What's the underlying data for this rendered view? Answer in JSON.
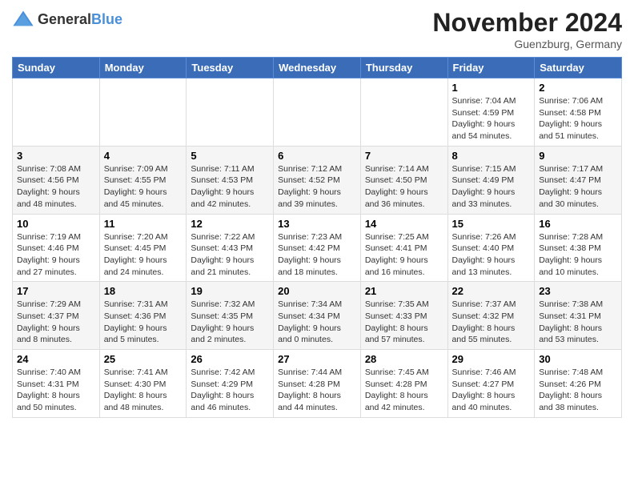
{
  "header": {
    "logo_general": "General",
    "logo_blue": "Blue",
    "month_title": "November 2024",
    "subtitle": "Guenzburg, Germany"
  },
  "weekdays": [
    "Sunday",
    "Monday",
    "Tuesday",
    "Wednesday",
    "Thursday",
    "Friday",
    "Saturday"
  ],
  "weeks": [
    [
      {
        "day": "",
        "info": ""
      },
      {
        "day": "",
        "info": ""
      },
      {
        "day": "",
        "info": ""
      },
      {
        "day": "",
        "info": ""
      },
      {
        "day": "",
        "info": ""
      },
      {
        "day": "1",
        "info": "Sunrise: 7:04 AM\nSunset: 4:59 PM\nDaylight: 9 hours and 54 minutes."
      },
      {
        "day": "2",
        "info": "Sunrise: 7:06 AM\nSunset: 4:58 PM\nDaylight: 9 hours and 51 minutes."
      }
    ],
    [
      {
        "day": "3",
        "info": "Sunrise: 7:08 AM\nSunset: 4:56 PM\nDaylight: 9 hours and 48 minutes."
      },
      {
        "day": "4",
        "info": "Sunrise: 7:09 AM\nSunset: 4:55 PM\nDaylight: 9 hours and 45 minutes."
      },
      {
        "day": "5",
        "info": "Sunrise: 7:11 AM\nSunset: 4:53 PM\nDaylight: 9 hours and 42 minutes."
      },
      {
        "day": "6",
        "info": "Sunrise: 7:12 AM\nSunset: 4:52 PM\nDaylight: 9 hours and 39 minutes."
      },
      {
        "day": "7",
        "info": "Sunrise: 7:14 AM\nSunset: 4:50 PM\nDaylight: 9 hours and 36 minutes."
      },
      {
        "day": "8",
        "info": "Sunrise: 7:15 AM\nSunset: 4:49 PM\nDaylight: 9 hours and 33 minutes."
      },
      {
        "day": "9",
        "info": "Sunrise: 7:17 AM\nSunset: 4:47 PM\nDaylight: 9 hours and 30 minutes."
      }
    ],
    [
      {
        "day": "10",
        "info": "Sunrise: 7:19 AM\nSunset: 4:46 PM\nDaylight: 9 hours and 27 minutes."
      },
      {
        "day": "11",
        "info": "Sunrise: 7:20 AM\nSunset: 4:45 PM\nDaylight: 9 hours and 24 minutes."
      },
      {
        "day": "12",
        "info": "Sunrise: 7:22 AM\nSunset: 4:43 PM\nDaylight: 9 hours and 21 minutes."
      },
      {
        "day": "13",
        "info": "Sunrise: 7:23 AM\nSunset: 4:42 PM\nDaylight: 9 hours and 18 minutes."
      },
      {
        "day": "14",
        "info": "Sunrise: 7:25 AM\nSunset: 4:41 PM\nDaylight: 9 hours and 16 minutes."
      },
      {
        "day": "15",
        "info": "Sunrise: 7:26 AM\nSunset: 4:40 PM\nDaylight: 9 hours and 13 minutes."
      },
      {
        "day": "16",
        "info": "Sunrise: 7:28 AM\nSunset: 4:38 PM\nDaylight: 9 hours and 10 minutes."
      }
    ],
    [
      {
        "day": "17",
        "info": "Sunrise: 7:29 AM\nSunset: 4:37 PM\nDaylight: 9 hours and 8 minutes."
      },
      {
        "day": "18",
        "info": "Sunrise: 7:31 AM\nSunset: 4:36 PM\nDaylight: 9 hours and 5 minutes."
      },
      {
        "day": "19",
        "info": "Sunrise: 7:32 AM\nSunset: 4:35 PM\nDaylight: 9 hours and 2 minutes."
      },
      {
        "day": "20",
        "info": "Sunrise: 7:34 AM\nSunset: 4:34 PM\nDaylight: 9 hours and 0 minutes."
      },
      {
        "day": "21",
        "info": "Sunrise: 7:35 AM\nSunset: 4:33 PM\nDaylight: 8 hours and 57 minutes."
      },
      {
        "day": "22",
        "info": "Sunrise: 7:37 AM\nSunset: 4:32 PM\nDaylight: 8 hours and 55 minutes."
      },
      {
        "day": "23",
        "info": "Sunrise: 7:38 AM\nSunset: 4:31 PM\nDaylight: 8 hours and 53 minutes."
      }
    ],
    [
      {
        "day": "24",
        "info": "Sunrise: 7:40 AM\nSunset: 4:31 PM\nDaylight: 8 hours and 50 minutes."
      },
      {
        "day": "25",
        "info": "Sunrise: 7:41 AM\nSunset: 4:30 PM\nDaylight: 8 hours and 48 minutes."
      },
      {
        "day": "26",
        "info": "Sunrise: 7:42 AM\nSunset: 4:29 PM\nDaylight: 8 hours and 46 minutes."
      },
      {
        "day": "27",
        "info": "Sunrise: 7:44 AM\nSunset: 4:28 PM\nDaylight: 8 hours and 44 minutes."
      },
      {
        "day": "28",
        "info": "Sunrise: 7:45 AM\nSunset: 4:28 PM\nDaylight: 8 hours and 42 minutes."
      },
      {
        "day": "29",
        "info": "Sunrise: 7:46 AM\nSunset: 4:27 PM\nDaylight: 8 hours and 40 minutes."
      },
      {
        "day": "30",
        "info": "Sunrise: 7:48 AM\nSunset: 4:26 PM\nDaylight: 8 hours and 38 minutes."
      }
    ]
  ]
}
